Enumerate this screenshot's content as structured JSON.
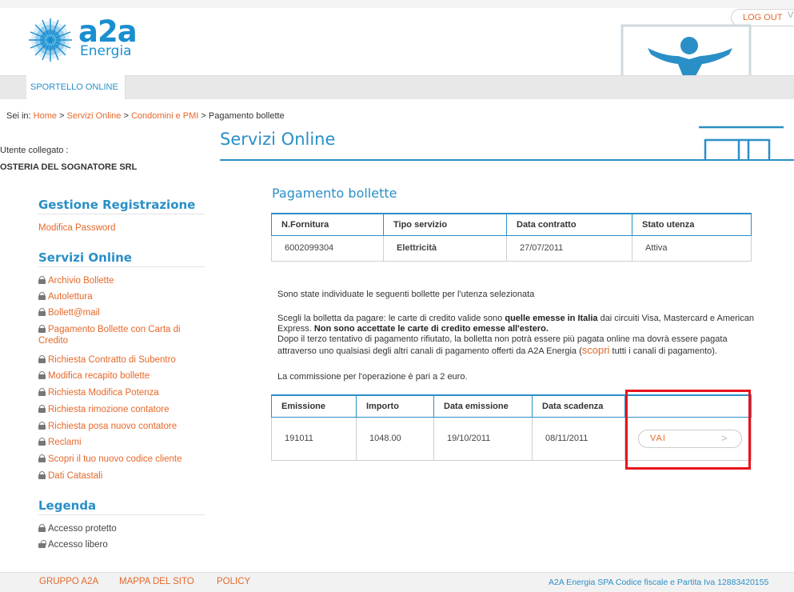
{
  "header": {
    "logo_text": "a2a",
    "logo_sub": "Energia",
    "logout_label": "LOG OUT",
    "logout_extra": "V",
    "nav_tab": "SPORTELLO ONLINE"
  },
  "breadcrumb": {
    "prefix": "Sei in:",
    "items": [
      "Home",
      "Servizi Online",
      "Condomini e PMI"
    ],
    "current": "Pagamento bollette",
    "sep": ">"
  },
  "page_title": "Servizi Online",
  "sidebar": {
    "user_label": "Utente collegato :",
    "user_name": "OSTERIA DEL SOGNATORE SRL",
    "registrazione_heading": "Gestione Registrazione",
    "registrazione_link": "Modifica Password",
    "servizi_heading": "Servizi Online",
    "servizi_items": [
      "Archivio Bollette",
      "Autolettura",
      "Bollett@mail",
      "Pagamento Bollette con Carta di Credito",
      "Richiesta Contratto di Subentro",
      "Modifica recapito bollette",
      "Richiesta Modifica Potenza",
      "Richiesta rimozione contatore",
      "Richiesta posa nuovo contatore",
      "Reclami",
      "Scopri il tuo nuovo codice cliente",
      "Dati Catastali"
    ],
    "legenda_heading": "Legenda",
    "legend_protected": "Accesso protetto",
    "legend_free": "Accesso libero"
  },
  "main": {
    "section_title": "Pagamento bollette",
    "supply_table": {
      "headers": [
        "N.Fornitura",
        "Tipo servizio",
        "Data contratto",
        "Stato utenza"
      ],
      "row": [
        "6002099304",
        "Elettricità",
        "27/07/2011",
        "Attiva"
      ]
    },
    "intro": "Sono state individuate le seguenti bollette per l'utenza selezionata",
    "card_p1": "Scegli la bolletta da pagare: le carte di credito valide sono ",
    "card_b1": "quelle emesse in Italia",
    "card_p2": " dai circuiti Visa, Mastercard e American Express. ",
    "card_b2": "Non sono accettate le carte di credito emesse all'estero.",
    "retry_p1": "Dopo il terzo tentativo di pagamento rifiutato, la bolletta non potrà essere più pagata online ma dovrà essere pagata attraverso uno qualsiasi degli altri canali di pagamento offerti da A2A Energia (",
    "retry_link": "scopri",
    "retry_p2": " tutti i canali di pagamento).",
    "commission": "La commissione per l'operazione è pari a 2 euro.",
    "bills_table": {
      "headers": [
        "Emissione",
        "Importo",
        "Data emissione",
        "Data scadenza",
        ""
      ],
      "row": [
        "191011",
        "1048.00",
        "19/10/2011",
        "08/11/2011"
      ]
    },
    "vai_label": "VAI",
    "vai_arrow": ">"
  },
  "footer": {
    "links": [
      "GRUPPO A2A",
      "MAPPA DEL SITO",
      "POLICY"
    ],
    "legal": "A2A Energia SPA Codice fiscale e Partita Iva 12883420155"
  },
  "colors": {
    "accent_blue": "#2a8fc7",
    "link_orange": "#e5682a",
    "highlight_red": "#e8141c"
  }
}
